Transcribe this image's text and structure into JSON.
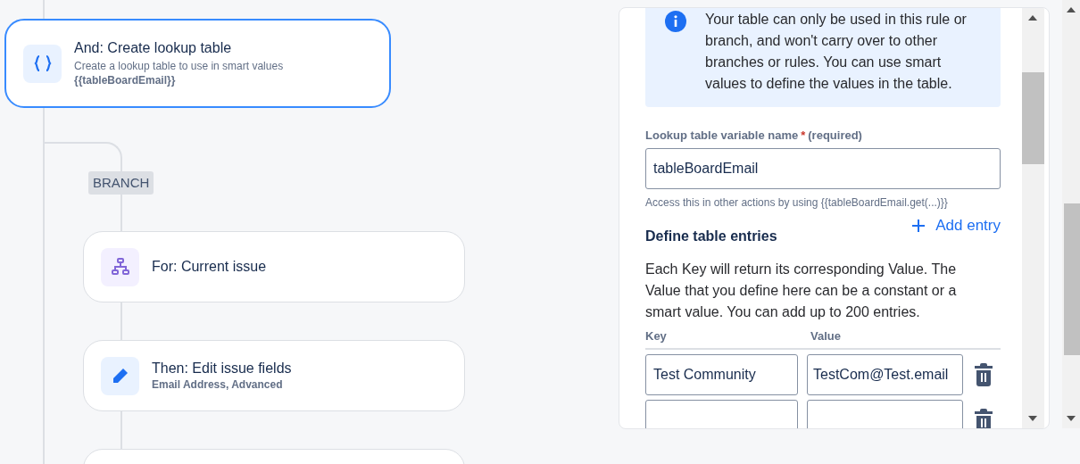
{
  "canvas": {
    "nodes": [
      {
        "kind": "lookup",
        "selected": true,
        "title": "And: Create lookup table",
        "subtitle": "Create a lookup table to use in smart values",
        "detail": "{{tableBoardEmail}}"
      },
      {
        "kind": "branch-label",
        "label": "BRANCH"
      },
      {
        "kind": "for",
        "selected": false,
        "title": "For: Current issue"
      },
      {
        "kind": "edit",
        "selected": false,
        "title": "Then: Edit issue fields",
        "detail": "Email Address, Advanced"
      },
      {
        "kind": "partial",
        "selected": false
      }
    ]
  },
  "panel": {
    "info": "Your table can only be used in this rule or branch, and won't carry over to other branches or rules. You can use smart values to define the values in the table.",
    "name_label": "Lookup table variable name",
    "required_mark": "*",
    "required_text": "(required)",
    "name_value": "tableBoardEmail",
    "name_help": "Access this in other actions by using {{tableBoardEmail.get(...)}}",
    "entries_title": "Define table entries",
    "add_label": "Add entry",
    "entries_help": "Each Key will return its corresponding Value. The Value that you define here can be a constant or a smart value. You can add up to 200 entries.",
    "columns": [
      "Key",
      "Value"
    ],
    "entries": [
      {
        "kind": "filled",
        "key": "Test Community",
        "value": "TestCom@Test.email"
      },
      {
        "kind": "blank"
      }
    ]
  }
}
